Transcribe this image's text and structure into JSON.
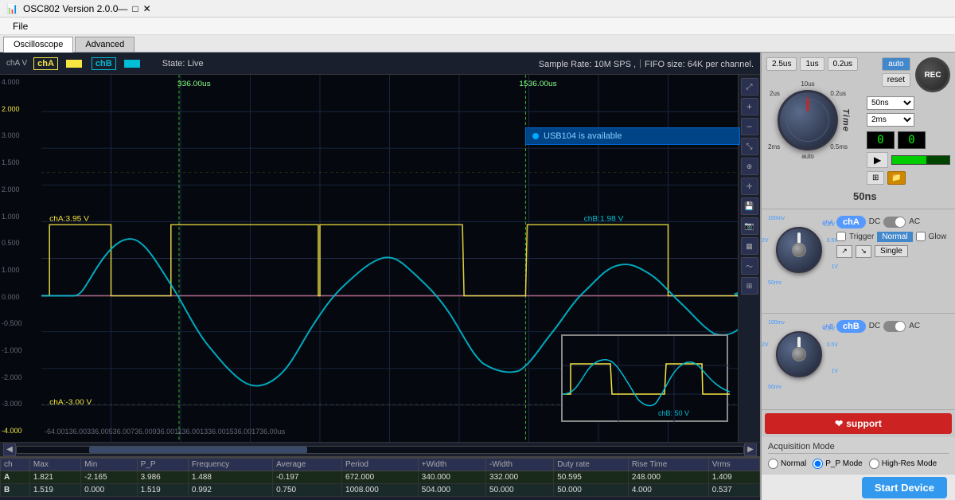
{
  "titlebar": {
    "title": "OSC802  Version 2.0.0",
    "minimize": "—",
    "maximize": "□",
    "close": "✕"
  },
  "menubar": {
    "file": "File"
  },
  "tabs": [
    {
      "id": "oscilloscope",
      "label": "Oscilloscope",
      "active": true
    },
    {
      "id": "advanced",
      "label": "Advanced",
      "active": false
    }
  ],
  "osc_header": {
    "ch_a_label": "chA",
    "ch_b_label": "chB",
    "state": "State: Live",
    "sample_rate": "Sample Rate: 10M SPS ,｜FIFO size: 64K per channel.",
    "y_axis_label": "chA V"
  },
  "usb_bar": {
    "text": "USB104  is available"
  },
  "time_markers": {
    "left": "336.00us",
    "right": "1536.00us"
  },
  "ch_values": {
    "cha_pos": "chA:3.95 V",
    "chb_pos": "chB:1.98 V",
    "cha_neg": "chA:-3.00 V"
  },
  "y_axis_values": [
    "4.000",
    "2.000",
    "3.000",
    "1.500",
    "2.000",
    "1.000",
    "0.500",
    "1.000",
    "0.000",
    "-0.500",
    "-1.000",
    "-2.000",
    "-3.000",
    "-4.000",
    "-2.000"
  ],
  "x_axis_values": [
    "-64.00",
    "136.00",
    "336.00",
    "536.00",
    "736.00",
    "936.00",
    "1136.00",
    "1336.00",
    "1536.00",
    "1736.00"
  ],
  "x_unit": "us",
  "timebase": {
    "tb1": "2.5us",
    "tb2": "1us",
    "tb3": "0.2us",
    "auto_label": "auto",
    "reset_label": "reset",
    "time_label": "Time",
    "tb_select1": "50ns",
    "tb_select2": "2ms",
    "rec_label": "REC",
    "sons_label": "50ns"
  },
  "counters": {
    "left": "0",
    "right": "0"
  },
  "chA": {
    "label": "chA",
    "dc_label": "DC",
    "ac_label": "AC",
    "trigger_label": "Trigger",
    "normal_label": "Normal",
    "glow_label": "Glow",
    "single_label": "Single",
    "scales": [
      "100mv",
      "0.2V",
      "0.5V",
      "1V",
      "50mv",
      "2V"
    ]
  },
  "chB": {
    "label": "chB",
    "dc_label": "DC",
    "ac_label": "AC",
    "scales": [
      "100mv",
      "0.2V",
      "0.5V",
      "1V",
      "50mv",
      "2V"
    ]
  },
  "support": {
    "label": "support"
  },
  "acquisition": {
    "title": "Acquisition Mode",
    "normal": "Normal",
    "pp_mode": "P_P Mode",
    "high_res": "High-Res Mode"
  },
  "measurements": {
    "headers": [
      "ch",
      "Max",
      "Min",
      "P_P",
      "Frequency",
      "Average",
      "Period",
      "+Width",
      "-Width",
      "Duty rate",
      "Rise Time",
      "Vrms"
    ],
    "rows": [
      {
        "ch": "A",
        "max": "1.821",
        "min": "-2.165",
        "pp": "3.986",
        "frequency": "1.488",
        "average": "-0.197",
        "period": "672.000",
        "plus_width": "340.000",
        "minus_width": "332.000",
        "duty_rate": "50.595",
        "rise_time": "248.000",
        "vrms": "1.409"
      },
      {
        "ch": "B",
        "max": "1.519",
        "min": "0.000",
        "pp": "1.519",
        "frequency": "0.992",
        "average": "0.750",
        "period": "1008.000",
        "plus_width": "504.000",
        "minus_width": "50.000",
        "duty_rate": "50.000",
        "rise_time": "4.000",
        "vrms": "0.537"
      }
    ]
  },
  "bottom": {
    "start_device": "Start Device"
  },
  "mini_scope": {
    "label": "chB: 50 V"
  }
}
